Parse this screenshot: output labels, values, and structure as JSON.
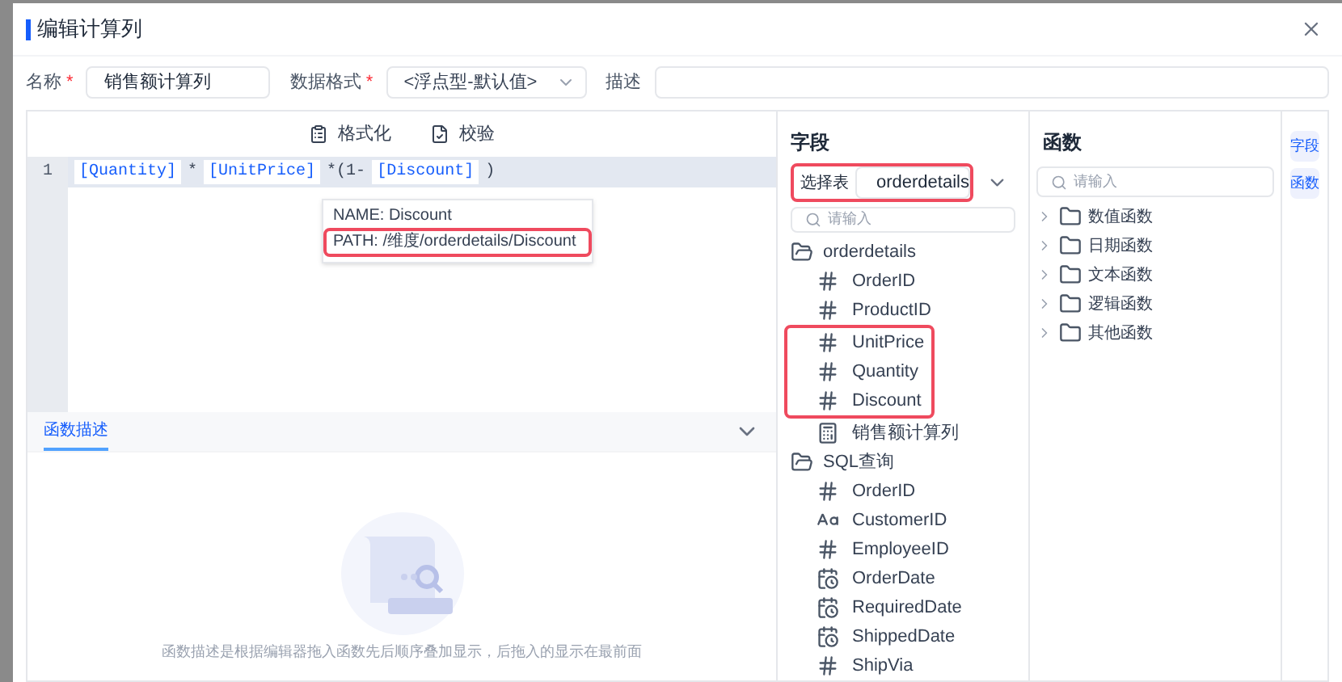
{
  "dialog": {
    "title": "编辑计算列"
  },
  "form": {
    "name_label": "名称",
    "name_required": true,
    "name_value": "销售额计算列",
    "format_label": "数据格式",
    "format_required": true,
    "format_value": "<浮点型-默认值>",
    "desc_label": "描述"
  },
  "toolbar": [
    {
      "label": "格式化",
      "kind": "format"
    },
    {
      "label": "校验",
      "kind": "check"
    }
  ],
  "editor": {
    "line_number": "1",
    "tokens": [
      {
        "kind": "field",
        "text": "[Quantity]"
      },
      {
        "kind": "op",
        "text": "*"
      },
      {
        "kind": "field",
        "text": "[UnitPrice]"
      },
      {
        "kind": "op",
        "text": "*(1-"
      },
      {
        "kind": "field",
        "text": "[Discount]"
      },
      {
        "kind": "op",
        "text": ")"
      }
    ]
  },
  "tooltip": {
    "name_line": "NAME: Discount",
    "path_line": "PATH: /维度/orderdetails/Discount",
    "highlighted": true
  },
  "description_panel": {
    "tab": "函数描述",
    "tab_selected": true,
    "empty_text": "函数描述是根据编辑器拖入函数先后顺序叠加显示，后拖入的显示在最前面"
  },
  "fields_panel": {
    "title": "字段",
    "table_label": "选择表",
    "table_value": "orderdetails",
    "table_highlighted": true,
    "search_placeholder": "请输入",
    "tree": [
      {
        "label": "orderdetails",
        "children": [
          {
            "label": "OrderID",
            "kind": "number",
            "highlighted": false
          },
          {
            "label": "ProductID",
            "kind": "number",
            "highlighted": false
          },
          {
            "label": "UnitPrice",
            "kind": "number",
            "highlighted": true
          },
          {
            "label": "Quantity",
            "kind": "number",
            "highlighted": true
          },
          {
            "label": "Discount",
            "kind": "number",
            "highlighted": true
          },
          {
            "label": "销售额计算列",
            "kind": "calculated",
            "highlighted": false
          }
        ]
      },
      {
        "label": "SQL查询",
        "children": [
          {
            "label": "OrderID",
            "kind": "number",
            "highlighted": false
          },
          {
            "label": "CustomerID",
            "kind": "text",
            "highlighted": false
          },
          {
            "label": "EmployeeID",
            "kind": "number",
            "highlighted": false
          },
          {
            "label": "OrderDate",
            "kind": "date",
            "highlighted": false
          },
          {
            "label": "RequiredDate",
            "kind": "date",
            "highlighted": false
          },
          {
            "label": "ShippedDate",
            "kind": "date",
            "highlighted": false
          },
          {
            "label": "ShipVia",
            "kind": "number",
            "highlighted": false
          }
        ]
      }
    ]
  },
  "functions_panel": {
    "title": "函数",
    "search_placeholder": "请输入",
    "groups": [
      {
        "label": "数值函数",
        "expanded": false
      },
      {
        "label": "日期函数",
        "expanded": false
      },
      {
        "label": "文本函数",
        "expanded": false
      },
      {
        "label": "逻辑函数",
        "expanded": false
      },
      {
        "label": "其他函数",
        "expanded": false
      }
    ]
  },
  "side_tabs": [
    {
      "label": "字段",
      "selected": true
    },
    {
      "label": "函数",
      "selected": true
    }
  ]
}
